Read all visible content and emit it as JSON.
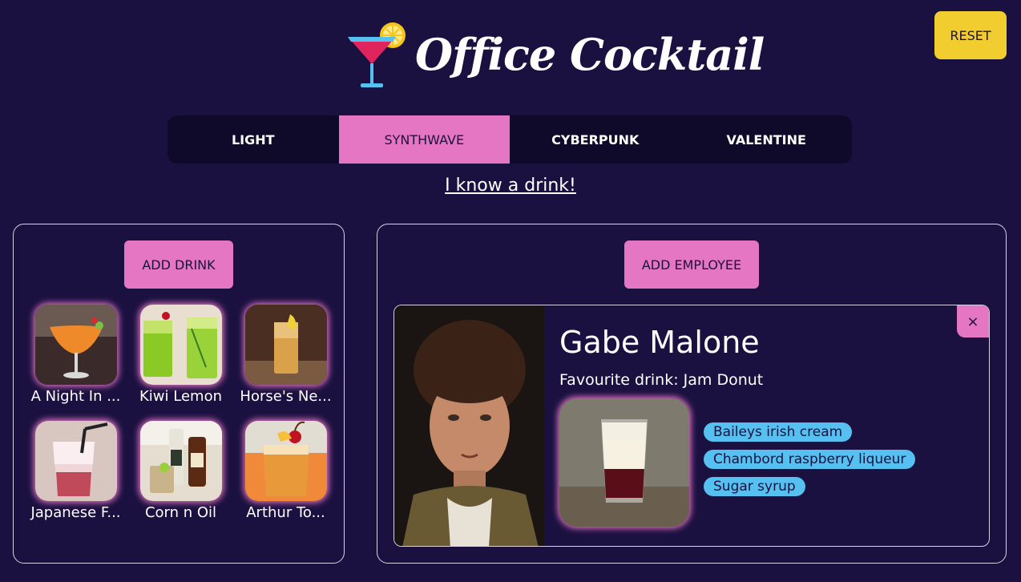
{
  "app": {
    "title": "Office Cocktail",
    "reset_label": "RESET"
  },
  "themes": {
    "tabs": [
      {
        "label": "LIGHT",
        "active": false
      },
      {
        "label": "SYNTHWAVE",
        "active": true
      },
      {
        "label": "CYBERPUNK",
        "active": false
      },
      {
        "label": "VALENTINE",
        "active": false
      }
    ]
  },
  "know_link": "I know a drink!",
  "drinks_panel": {
    "add_label": "ADD DRINK",
    "drinks": [
      {
        "name": "A Night In ...",
        "icon": "orange-cocktail-glass"
      },
      {
        "name": "Kiwi Lemon",
        "icon": "green-highball-glasses"
      },
      {
        "name": "Horse's Ne...",
        "icon": "tall-glass-lemon"
      },
      {
        "name": "Japanese F...",
        "icon": "pink-fizz-glass"
      },
      {
        "name": "Corn n Oil",
        "icon": "bottles-and-rocks-glass"
      },
      {
        "name": "Arthur To...",
        "icon": "orange-sour-cherry"
      }
    ]
  },
  "employees_panel": {
    "add_label": "ADD EMPLOYEE",
    "employee": {
      "name": "Gabe Malone",
      "favourite": "Favourite drink: Jam Donut",
      "ingredients": [
        "Baileys irish cream",
        "Chambord raspberry liqueur",
        "Sugar syrup"
      ],
      "close_label": "×"
    }
  },
  "colors": {
    "background": "#1b1140",
    "accent_pink": "#e576c3",
    "reset_yellow": "#f2cd2f",
    "tag_blue": "#56c1f0"
  }
}
